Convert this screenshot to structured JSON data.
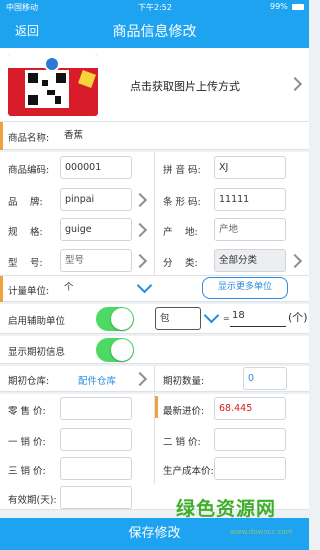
{
  "status_bar": {
    "carrier": "中国移动",
    "time": "下午2:52",
    "battery": "99%"
  },
  "nav": {
    "back": "返回",
    "title": "商品信息修改"
  },
  "photo": {
    "text": "点击获取图片上传方式"
  },
  "product_name": {
    "label": "商品名称:",
    "value": "香蕉"
  },
  "rows": {
    "code": {
      "label": "商品编码:",
      "value": "000001"
    },
    "pinyin": {
      "label": "拼 音 码:",
      "value": "XJ"
    },
    "brand": {
      "label": "品　 牌:",
      "value": "pinpai"
    },
    "barcode": {
      "label": "条 形 码:",
      "value": "11111"
    },
    "spec": {
      "label": "规　 格:",
      "value": "guige"
    },
    "origin": {
      "label": "产　 地:",
      "placeholder": "产地"
    },
    "model": {
      "label": "型　 号:",
      "placeholder": "型号"
    },
    "category": {
      "label": "分　 类:",
      "value": "全部分类"
    }
  },
  "unit": {
    "label": "计量单位:",
    "value": "个",
    "more_button": "显示更多单位"
  },
  "aux_unit": {
    "label": "启用辅助单位",
    "value": "包",
    "equals": "=",
    "ratio": "18",
    "suffix": "(个)",
    "enabled": true
  },
  "initial_info": {
    "label": "显示期初信息",
    "enabled": true
  },
  "warehouse": {
    "label": "期初仓库:",
    "value": "配件仓库",
    "qty_label": "期初数量:",
    "qty_value": "0"
  },
  "prices": {
    "retail_label": "零 售 价:",
    "latest_label": "最新进价:",
    "latest_value": "68.445",
    "p1_label": "一 销 价:",
    "p2_label": "二 销 价:",
    "p3_label": "三 销 价:",
    "cost_label": "生产成本价:",
    "expiry_label": "有效期(天):"
  },
  "save_button": "保存修改",
  "watermark": {
    "text": "绿色资源网",
    "url": "www.downcc.com"
  },
  "colors": {
    "primary": "#1da3f0",
    "accent": "#f0a33c",
    "toggle_on": "#4cd964",
    "price_red": "#d0211c",
    "link_blue": "#2d8be0"
  }
}
